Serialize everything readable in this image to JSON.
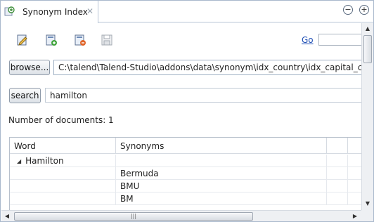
{
  "tab": {
    "label": "Synonym Index",
    "icon": "synonym-index-icon",
    "close_glyph": "✕"
  },
  "window_controls": {
    "minimize_glyph": "−",
    "maximize_glyph": "+"
  },
  "toolbar": {
    "icons": [
      "edit-document-icon",
      "add-document-icon",
      "remove-document-icon",
      "save-icon"
    ]
  },
  "go": {
    "label": "Go",
    "value": ""
  },
  "browse": {
    "button_label": "browse...",
    "path": "C:\\talend\\Talend-Studio\\addons\\data\\synonym\\idx_country\\idx_capital_country"
  },
  "search": {
    "button_label": "search",
    "query": "hamilton"
  },
  "documents": {
    "count_text": "Number of documents: 1"
  },
  "table": {
    "columns": [
      "Word",
      "Synonyms"
    ],
    "rows": [
      {
        "word": "Hamilton",
        "synonym": "",
        "expanded": true
      },
      {
        "word": "",
        "synonym": "Bermuda"
      },
      {
        "word": "",
        "synonym": "BMU"
      },
      {
        "word": "",
        "synonym": "BM"
      }
    ],
    "twisty_glyph": "◢"
  },
  "scrollbars": {
    "up": "▲",
    "down": "▼",
    "left": "◀",
    "right": "▶",
    "grip": "|||"
  },
  "colors": {
    "link": "#1f4fb5",
    "border": "#a9b8cc"
  }
}
